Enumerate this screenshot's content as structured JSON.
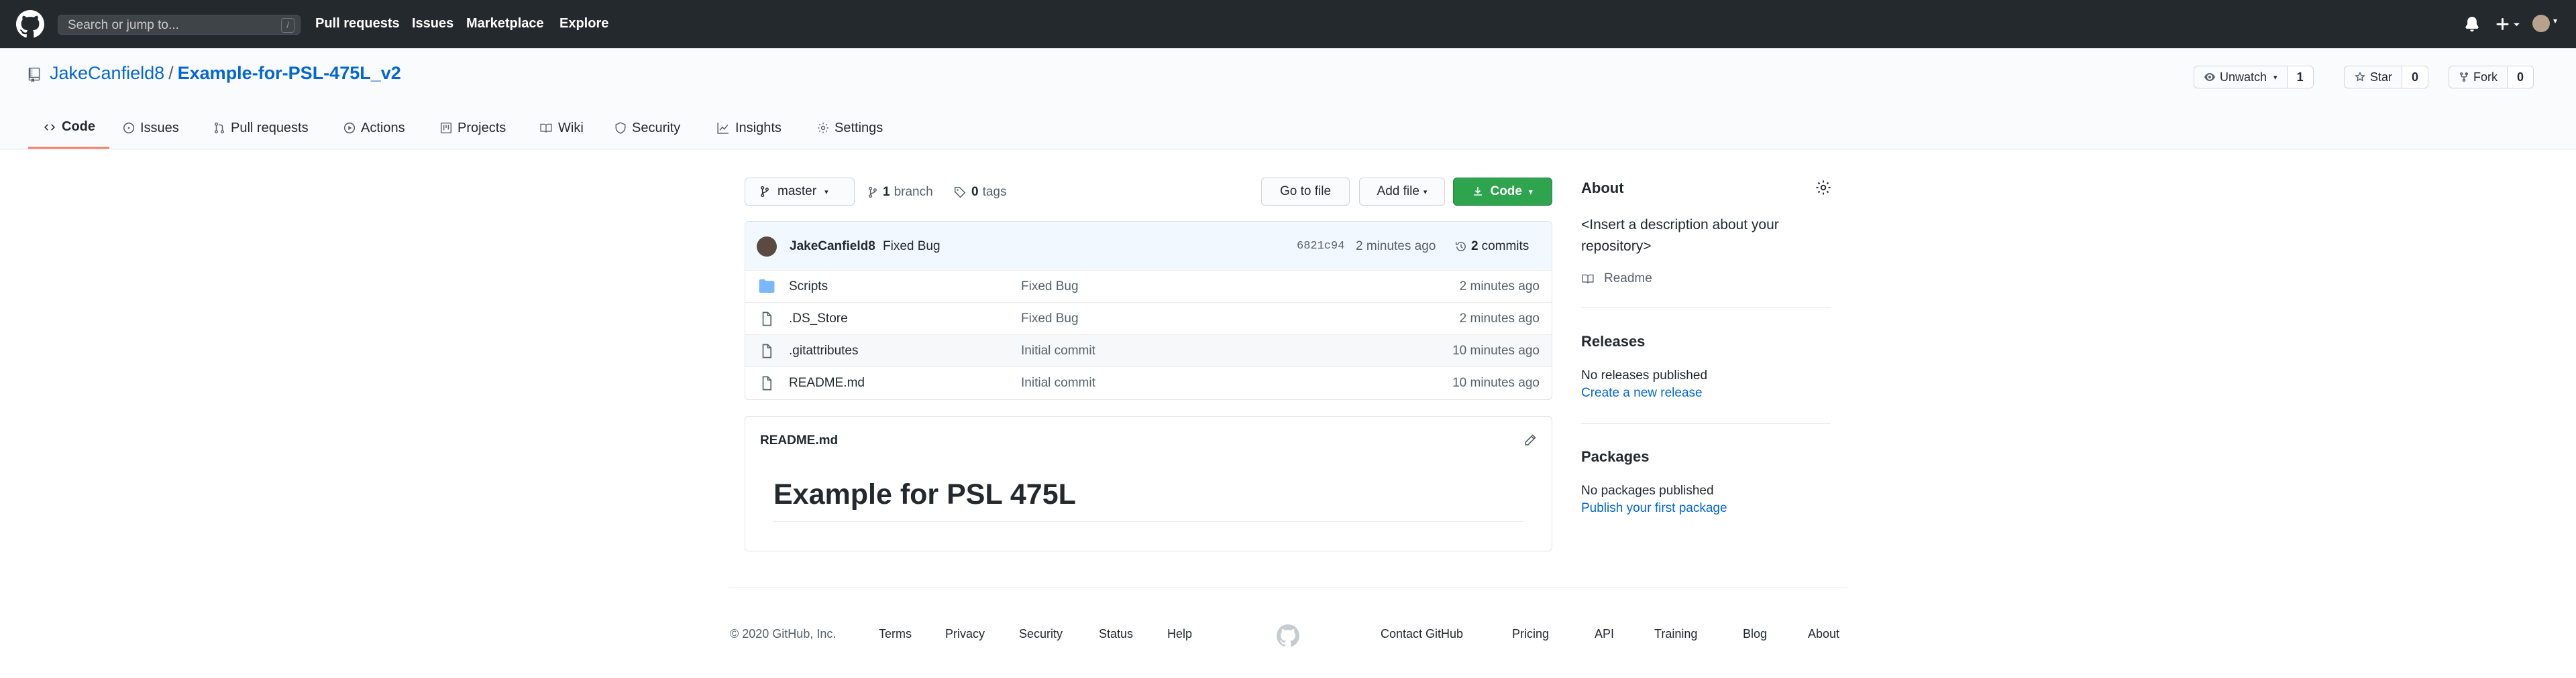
{
  "topnav": {
    "logo_icon": "github-mark-icon",
    "search_placeholder": "Search or jump to...",
    "search_shortcut": "/",
    "links": [
      "Pull requests",
      "Issues",
      "Marketplace",
      "Explore"
    ],
    "notification_icon": "bell-icon",
    "create_icon": "plus-icon",
    "avatar_caret": "▾"
  },
  "repo": {
    "owner": "JakeCanfield8",
    "separator": "/",
    "name": "Example-for-PSL-475L_v2",
    "watch_label": "Unwatch",
    "watch_caret": "▾",
    "watch_count": "1",
    "star_label": "Star",
    "star_count": "0",
    "fork_label": "Fork",
    "fork_count": "0"
  },
  "tabs": [
    {
      "label": "Code",
      "icon": "code-icon",
      "selected": true
    },
    {
      "label": "Issues",
      "icon": "issue-icon"
    },
    {
      "label": "Pull requests",
      "icon": "pull-request-icon"
    },
    {
      "label": "Actions",
      "icon": "play-icon"
    },
    {
      "label": "Projects",
      "icon": "project-icon"
    },
    {
      "label": "Wiki",
      "icon": "book-icon"
    },
    {
      "label": "Security",
      "icon": "shield-icon"
    },
    {
      "label": "Insights",
      "icon": "graph-icon"
    },
    {
      "label": "Settings",
      "icon": "gear-icon"
    }
  ],
  "toolbar": {
    "branch": "master",
    "caret": "▾",
    "branch_count": "1",
    "branch_label": "branch",
    "tag_count": "0",
    "tag_label": "tags",
    "go_to_file": "Go to file",
    "add_file": "Add file",
    "code": "Code"
  },
  "commit": {
    "author": "JakeCanfield8",
    "message": "Fixed Bug",
    "sha": "6821c94",
    "time": "2 minutes ago",
    "count": "2",
    "count_label": "commits"
  },
  "files": [
    {
      "name": "Scripts",
      "type": "folder",
      "message": "Fixed Bug",
      "age": "2 minutes ago"
    },
    {
      "name": ".DS_Store",
      "type": "file",
      "message": "Fixed Bug",
      "age": "2 minutes ago"
    },
    {
      "name": ".gitattributes",
      "type": "file",
      "message": "Initial commit",
      "age": "10 minutes ago"
    },
    {
      "name": "README.md",
      "type": "file",
      "message": "Initial commit",
      "age": "10 minutes ago"
    }
  ],
  "readme": {
    "title": "README.md",
    "heading": "Example for PSL 475L"
  },
  "about": {
    "heading": "About",
    "description": "<Insert a description about your repository>",
    "readme_link": "Readme"
  },
  "releases": {
    "heading": "Releases",
    "text": "No releases published",
    "link": "Create a new release"
  },
  "packages": {
    "heading": "Packages",
    "text": "No packages published",
    "link": "Publish your first package"
  },
  "footer": {
    "copyright": "© 2020 GitHub, Inc.",
    "left_links": [
      "Terms",
      "Privacy",
      "Security",
      "Status",
      "Help"
    ],
    "right_links": [
      "Contact GitHub",
      "Pricing",
      "API",
      "Training",
      "Blog",
      "About"
    ]
  },
  "colors": {
    "header_bg": "#24292e",
    "link": "#0366d6",
    "primary_button": "#2ea44f",
    "tab_underline": "#f9826c"
  }
}
